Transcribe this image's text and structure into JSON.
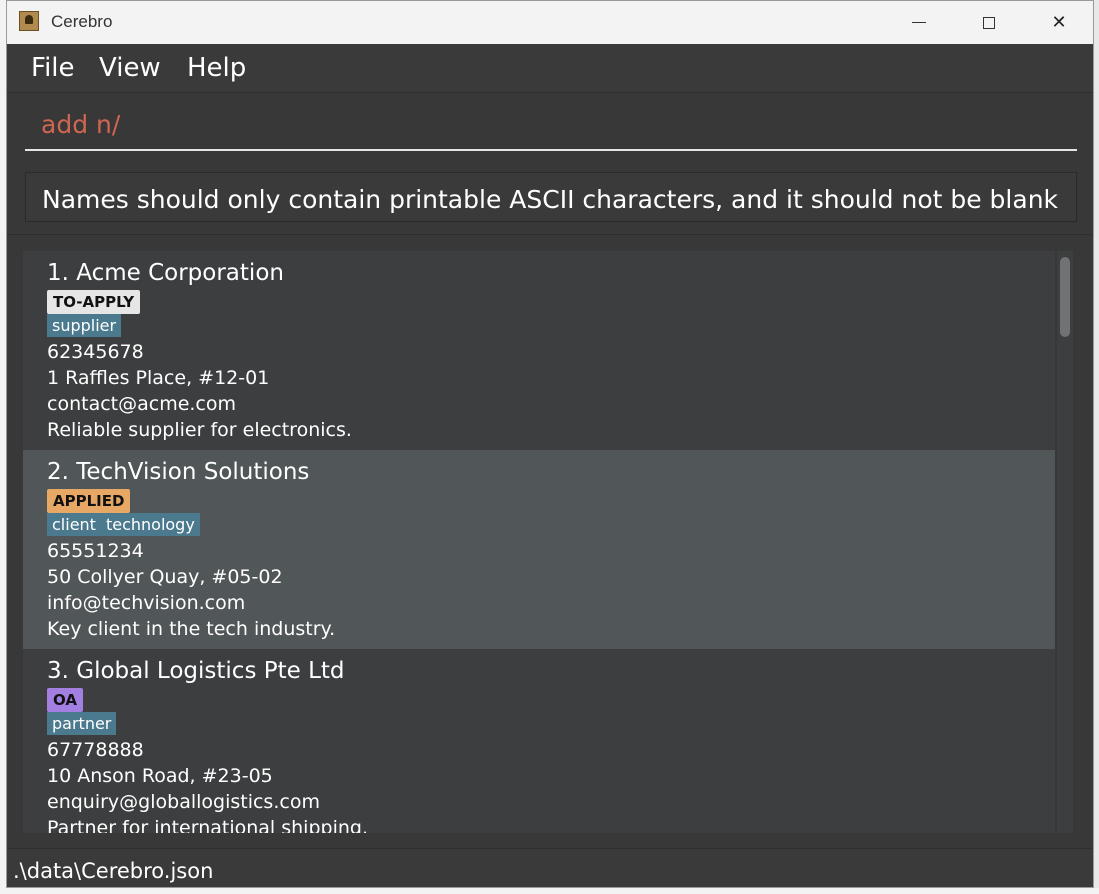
{
  "window": {
    "title": "Cerebro",
    "app_icon": "contact-book-icon"
  },
  "menu": {
    "file": "File",
    "view": "View",
    "help": "Help"
  },
  "command": {
    "value": "add n/"
  },
  "result": {
    "message": "Names should only contain printable ASCII characters, and it should not be blank"
  },
  "companies": [
    {
      "index_name": "1. Acme Corporation",
      "status": "TO-APPLY",
      "status_color": "#e6e6e6",
      "tags": [
        "supplier"
      ],
      "phone": "62345678",
      "address": "1 Raffles Place, #12-01",
      "email": "contact@acme.com",
      "description": "Reliable supplier for electronics.",
      "selected": false
    },
    {
      "index_name": "2. TechVision Solutions",
      "status": "APPLIED",
      "status_color": "#e7a866",
      "tags": [
        "client",
        "technology"
      ],
      "phone": "65551234",
      "address": "50 Collyer Quay, #05-02",
      "email": "info@techvision.com",
      "description": "Key client in the tech industry.",
      "selected": true
    },
    {
      "index_name": "3. Global Logistics Pte Ltd",
      "status": "OA",
      "status_color": "#a27fe0",
      "tags": [
        "partner"
      ],
      "phone": "67778888",
      "address": "10 Anson Road, #23-05",
      "email": "enquiry@globallogistics.com",
      "description": "Partner for international shipping.",
      "selected": false
    }
  ],
  "status_bar": {
    "path": ".\\data\\Cerebro.json"
  },
  "colors": {
    "tag": "#4b7a8e",
    "selected_card": "#515658",
    "command_text": "#d06651"
  }
}
